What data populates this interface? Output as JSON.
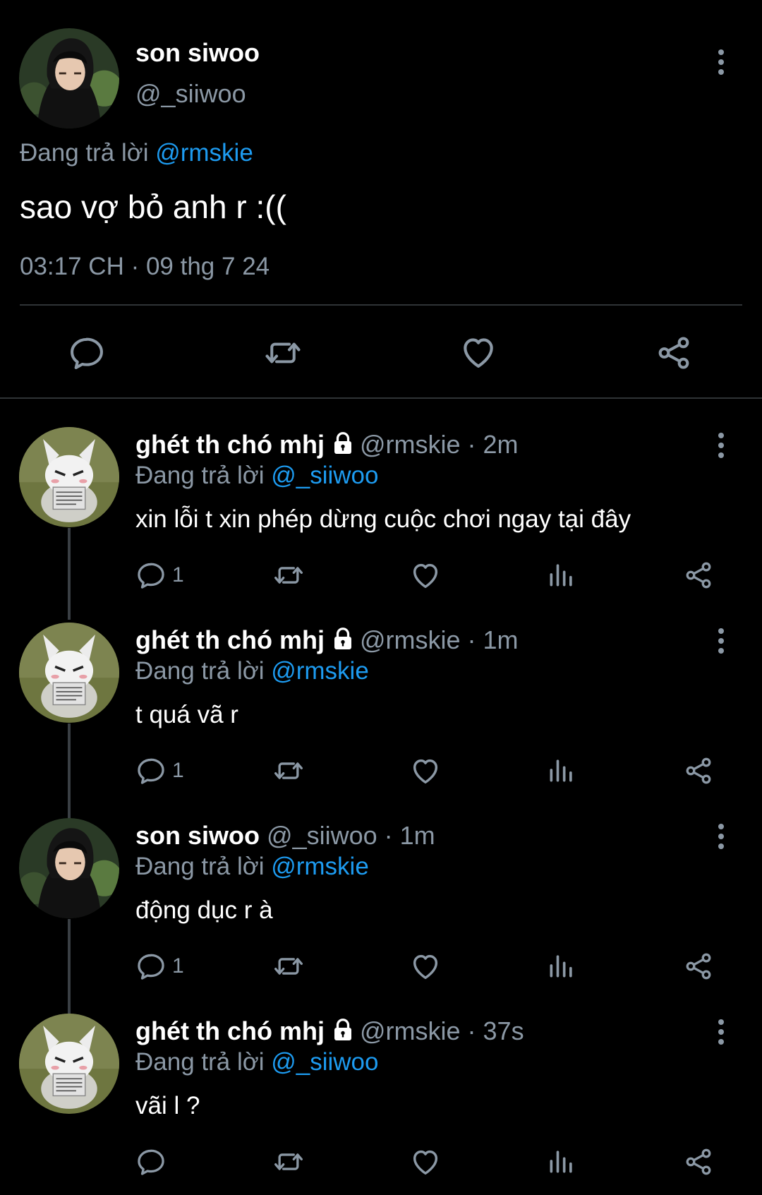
{
  "main_tweet": {
    "name": "son siwoo",
    "handle": "@_siiwoo",
    "replying_label": "Đang trả lời",
    "replying_to": "@rmskie",
    "text": "sao vợ bỏ anh r :((",
    "timestamp": "03:17 CH · 09 thg 7 24"
  },
  "replies": [
    {
      "name": "ghét th chó mhj",
      "handle": "@rmskie",
      "time": "· 2m",
      "replying_label": "Đang trả lời",
      "replying_to": "@_siiwoo",
      "text": "xin lỗi t xin phép dừng cuộc chơi ngay tại đây",
      "reply_count": "1"
    },
    {
      "name": "ghét th chó mhj",
      "handle": "@rmskie",
      "time": "· 1m",
      "replying_label": "Đang trả lời",
      "replying_to": "@rmskie",
      "text": "t quá vã r",
      "reply_count": "1"
    },
    {
      "name": "son siwoo",
      "handle": "@_siiwoo",
      "time": "· 1m",
      "replying_label": "Đang trả lời",
      "replying_to": "@rmskie",
      "text": "động dục r à",
      "reply_count": "1"
    },
    {
      "name": "ghét th chó mhj",
      "handle": "@rmskie",
      "time": "· 37s",
      "replying_label": "Đang trả lời",
      "replying_to": "@_siiwoo",
      "text": "vãi l ?",
      "reply_count": ""
    }
  ],
  "colors": {
    "background": "#000000",
    "text": "#e7e9ea",
    "muted": "#8b98a5",
    "accent": "#1d9bf0"
  },
  "icons": [
    "more-vertical-icon",
    "reply-icon",
    "retweet-icon",
    "like-icon",
    "share-icon",
    "analytics-icon",
    "lock-icon"
  ]
}
